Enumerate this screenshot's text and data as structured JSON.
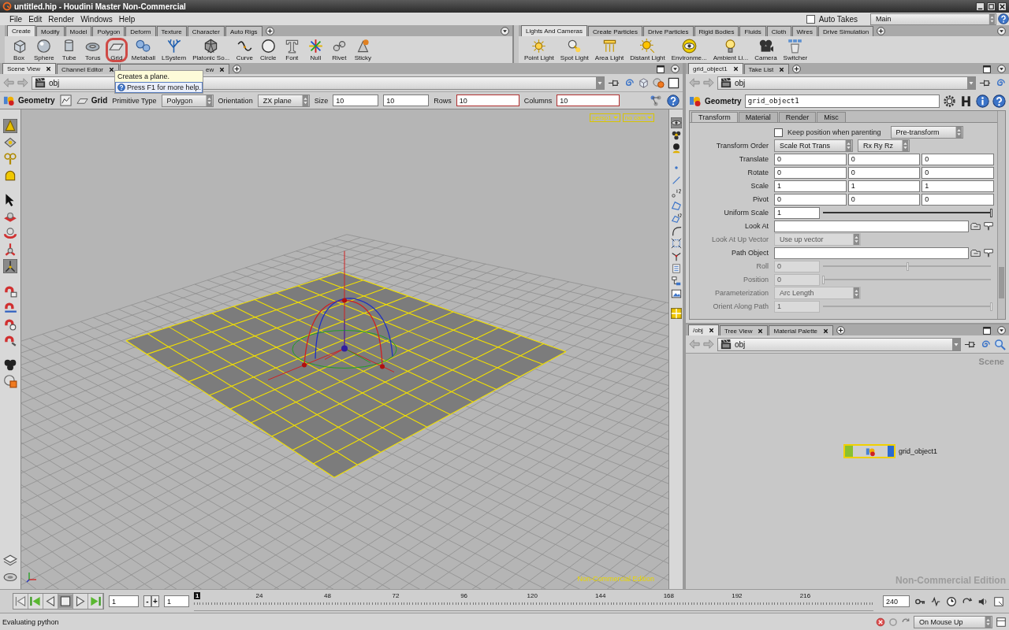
{
  "window": {
    "title": "untitled.hip - Houdini Master Non-Commercial"
  },
  "menu_bar": {
    "items": [
      "File",
      "Edit",
      "Render",
      "Windows",
      "Help"
    ],
    "auto_takes": {
      "label": "Auto Takes",
      "checked": false
    },
    "take": "Main"
  },
  "shelves": [
    {
      "tabs": [
        {
          "label": "Create",
          "selected": true
        },
        {
          "label": "Modify",
          "selected": false
        },
        {
          "label": "Model",
          "selected": false
        },
        {
          "label": "Polygon",
          "selected": false
        },
        {
          "label": "Deform",
          "selected": false
        },
        {
          "label": "Texture",
          "selected": false
        },
        {
          "label": "Character",
          "selected": false
        },
        {
          "label": "Auto Rigs",
          "selected": false
        }
      ],
      "tools": [
        {
          "label": "Box",
          "highlighted": false
        },
        {
          "label": "Sphere",
          "highlighted": false
        },
        {
          "label": "Tube",
          "highlighted": false
        },
        {
          "label": "Torus",
          "highlighted": false
        },
        {
          "label": "Grid",
          "highlighted": true
        },
        {
          "label": "Metaball",
          "highlighted": false
        },
        {
          "label": "LSystem",
          "highlighted": false
        },
        {
          "label": "Platonic So...",
          "highlighted": false
        },
        {
          "label": "Curve",
          "highlighted": false
        },
        {
          "label": "Circle",
          "highlighted": false
        },
        {
          "label": "Font",
          "highlighted": false
        },
        {
          "label": "Null",
          "highlighted": false
        },
        {
          "label": "Rivet",
          "highlighted": false
        },
        {
          "label": "Sticky",
          "highlighted": false
        }
      ]
    },
    {
      "tabs": [
        {
          "label": "Lights And Cameras",
          "selected": true
        },
        {
          "label": "Create Particles",
          "selected": false
        },
        {
          "label": "Drive Particles",
          "selected": false
        },
        {
          "label": "Rigid Bodies",
          "selected": false
        },
        {
          "label": "Fluids",
          "selected": false
        },
        {
          "label": "Cloth",
          "selected": false
        },
        {
          "label": "Wires",
          "selected": false
        },
        {
          "label": "Drive Simulation",
          "selected": false
        }
      ],
      "tools": [
        {
          "label": "Point Light",
          "highlighted": false
        },
        {
          "label": "Spot Light",
          "highlighted": false
        },
        {
          "label": "Area Light",
          "highlighted": false
        },
        {
          "label": "Distant Light",
          "highlighted": false
        },
        {
          "label": "Environme...",
          "highlighted": false
        },
        {
          "label": "Ambient Li...",
          "highlighted": false
        },
        {
          "label": "Camera",
          "highlighted": false
        },
        {
          "label": "Switcher",
          "highlighted": false
        }
      ]
    }
  ],
  "tooltip": {
    "title": "Creates a plane.",
    "help": "Press F1 for more help."
  },
  "scene_view": {
    "tabs": [
      {
        "label": "Scene View",
        "selected": true
      },
      {
        "label": "Channel Editor",
        "selected": false
      },
      {
        "label": "ew",
        "selected": false
      }
    ],
    "path": "obj",
    "operation": {
      "context": "Geometry",
      "tool": "Grid",
      "fields": [
        {
          "kind": "menu",
          "label": "Primitive Type",
          "value": "Polygon"
        },
        {
          "kind": "menu",
          "label": "Orientation",
          "value": "ZX plane"
        },
        {
          "kind": "pair",
          "label": "Size",
          "values": [
            "10",
            "10"
          ]
        },
        {
          "kind": "text",
          "label": "Rows",
          "value": "10",
          "highlighted": true
        },
        {
          "kind": "text",
          "label": "Columns",
          "value": "10",
          "highlighted": true
        }
      ]
    },
    "left_toolbar": [
      {
        "selected": true
      },
      {
        "selected": false
      },
      {
        "selected": false
      },
      {
        "selected": false
      },
      {
        "selected": false
      },
      {
        "selected": false
      },
      {
        "selected": false
      },
      {
        "selected": false
      },
      {
        "selected": true
      },
      {
        "selected": false
      },
      {
        "selected": false
      },
      {
        "selected": false
      },
      {
        "selected": false
      },
      {
        "selected": false
      },
      {
        "selected": false
      },
      {
        "selected": false
      },
      {
        "selected": false
      }
    ],
    "right_toolbar": [
      {
        "selected": true
      },
      {
        "selected": false
      },
      {
        "selected": false
      },
      {
        "selected": false
      },
      {
        "selected": false
      },
      {
        "selected": false
      },
      {
        "selected": false
      },
      {
        "selected": false
      },
      {
        "selected": false
      },
      {
        "selected": false
      },
      {
        "selected": false
      },
      {
        "selected": false
      },
      {
        "selected": false
      },
      {
        "selected": false
      },
      {
        "selected": true
      }
    ],
    "camera_menus": [
      "persp1",
      "no cam"
    ],
    "edition_label": "Non-Commercial Edition"
  },
  "parameters": {
    "tabs": [
      {
        "label": "grid_object1",
        "selected": true
      },
      {
        "label": "Take List",
        "selected": false
      }
    ],
    "path": "obj",
    "node_type": "Geometry",
    "node_name": "grid_object1",
    "sections": [
      {
        "label": "Transform",
        "selected": true
      },
      {
        "label": "Material",
        "selected": false
      },
      {
        "label": "Render",
        "selected": false
      },
      {
        "label": "Misc",
        "selected": false
      }
    ],
    "rows": [
      {
        "kind": "check_menu",
        "label": "Keep position when parenting",
        "checked": false,
        "value": "Pre-transform",
        "disabled": false
      },
      {
        "kind": "menus",
        "label": "Transform Order",
        "values": [
          "Scale Rot Trans",
          "Rx Ry Rz"
        ],
        "disabled": false
      },
      {
        "kind": "vector",
        "label": "Translate",
        "values": [
          "0",
          "0",
          "0"
        ],
        "disabled": false
      },
      {
        "kind": "vector",
        "label": "Rotate",
        "values": [
          "0",
          "0",
          "0"
        ],
        "disabled": false
      },
      {
        "kind": "vector",
        "label": "Scale",
        "values": [
          "1",
          "1",
          "1"
        ],
        "disabled": false
      },
      {
        "kind": "vector",
        "label": "Pivot",
        "values": [
          "0",
          "0",
          "0"
        ],
        "disabled": false
      },
      {
        "kind": "slider",
        "label": "Uniform Scale",
        "value": "1",
        "level": 1,
        "disabled": false
      },
      {
        "kind": "path",
        "label": "Look At",
        "disabled": false
      },
      {
        "kind": "menu",
        "label": "Look At Up Vector",
        "value": "Use up vector",
        "disabled": true
      },
      {
        "kind": "path",
        "label": "Path Object",
        "disabled": false
      },
      {
        "kind": "slider",
        "label": "Roll",
        "value": "0",
        "level": 0.5,
        "disabled": true
      },
      {
        "kind": "slider",
        "label": "Position",
        "value": "0",
        "level": 0,
        "disabled": true
      },
      {
        "kind": "menu",
        "label": "Parameterization",
        "value": "Arc Length",
        "disabled": true
      },
      {
        "kind": "slider",
        "label": "Orient Along Path",
        "value": "1",
        "level": 1,
        "disabled": true
      }
    ]
  },
  "network": {
    "tabs": [
      {
        "label": "/obj",
        "selected": true
      },
      {
        "label": "Tree View",
        "selected": false
      },
      {
        "label": "Material Palette",
        "selected": false
      }
    ],
    "path": "obj",
    "context_label": "Scene",
    "nodes": [
      {
        "name": "grid_object1",
        "selected": true
      }
    ],
    "edition_label": "Non-Commercial Edition"
  },
  "timeline": {
    "frame": "1",
    "step_buttons": [
      "-",
      "+"
    ],
    "start": "1",
    "current_frame": "1",
    "frame_labels": [
      "24",
      "48",
      "72",
      "96",
      "120",
      "144",
      "168",
      "192",
      "216"
    ],
    "end": "240"
  },
  "status_bar": {
    "message": "Evaluating python",
    "update_mode": "On Mouse Up"
  }
}
